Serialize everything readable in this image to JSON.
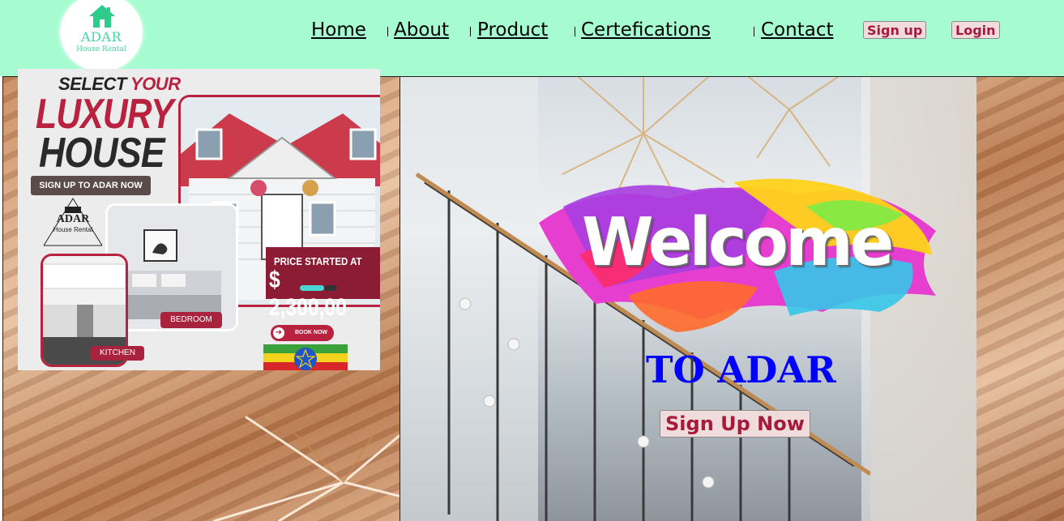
{
  "logo": {
    "name": "ADAR",
    "subtitle": "House Rental",
    "icon": "house-icon"
  },
  "nav": {
    "items": [
      {
        "label": "Home"
      },
      {
        "label": "About"
      },
      {
        "label": "Product"
      },
      {
        "label": "Certefications"
      },
      {
        "label": "Contact"
      }
    ],
    "signup_label": "Sign up",
    "login_label": "Login"
  },
  "ad": {
    "select": "SELECT",
    "your": "YOUR",
    "luxury": "LUXURY",
    "house": "HOUSE",
    "signup_text": "SIGN UP TO ADAR  NOW",
    "logo_name": "ADAR",
    "logo_sub": "House Rental",
    "price_label": "PRICE STARTED AT",
    "price": "$ 2,300,00",
    "bedroom": "BEDROOM",
    "kitchen": "KITCHEN",
    "book_now": "BOOK NOW"
  },
  "hero": {
    "welcome": "Welcome",
    "to_adar": "TO ADAR",
    "cta_label": "Sign Up Now"
  },
  "colors": {
    "header_bg": "#a6fcd0",
    "button_text": "#a61b3b",
    "to_adar": "#0000ff",
    "ad_accent": "#b8223f"
  }
}
